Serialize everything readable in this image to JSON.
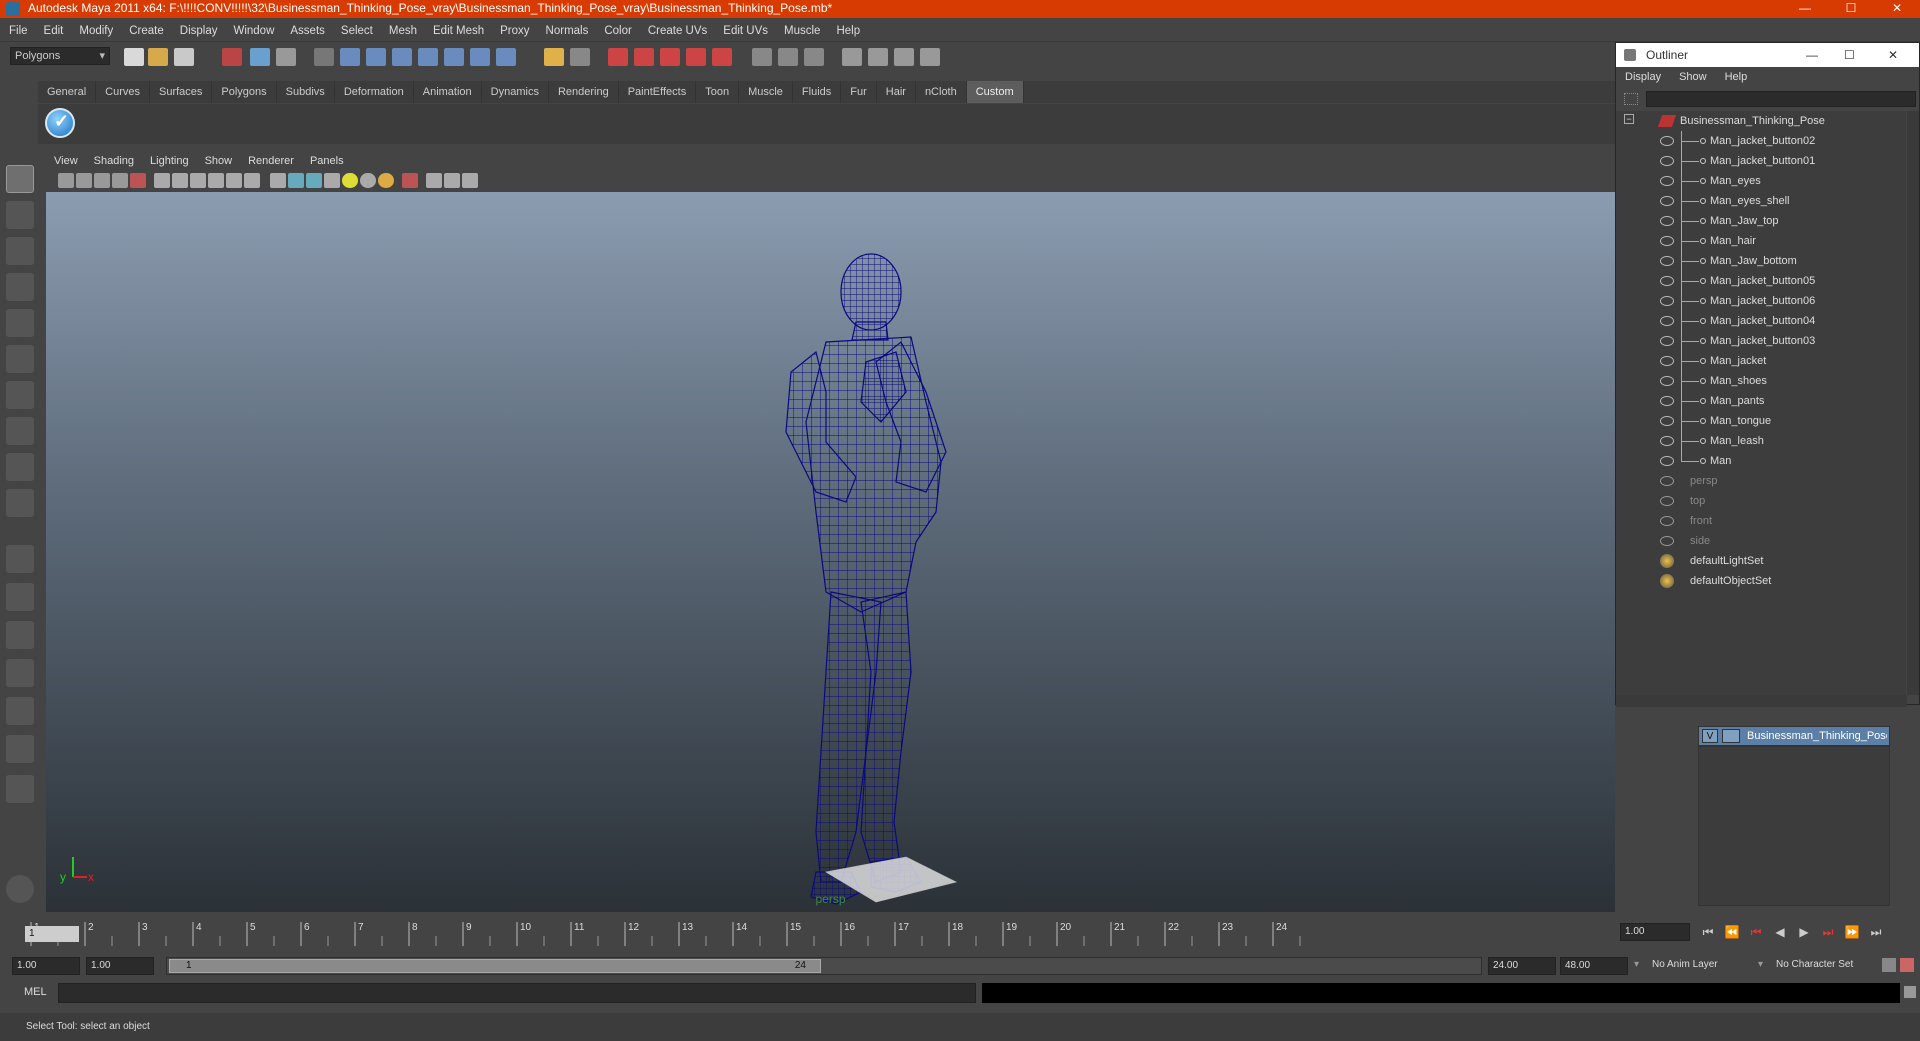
{
  "title": "Autodesk Maya 2011 x64: F:\\!!!!CONV!!!!!\\32\\Businessman_Thinking_Pose_vray\\Businessman_Thinking_Pose_vray\\Businessman_Thinking_Pose.mb*",
  "menu": [
    "File",
    "Edit",
    "Modify",
    "Create",
    "Display",
    "Window",
    "Assets",
    "Select",
    "Mesh",
    "Edit Mesh",
    "Proxy",
    "Normals",
    "Color",
    "Create UVs",
    "Edit UVs",
    "Muscle",
    "Help"
  ],
  "mode_select": "Polygons",
  "shelf_tabs": [
    "General",
    "Curves",
    "Surfaces",
    "Polygons",
    "Subdivs",
    "Deformation",
    "Animation",
    "Dynamics",
    "Rendering",
    "PaintEffects",
    "Toon",
    "Muscle",
    "Fluids",
    "Fur",
    "Hair",
    "nCloth",
    "Custom"
  ],
  "active_shelf_tab": "Custom",
  "viewport_menu": [
    "View",
    "Shading",
    "Lighting",
    "Show",
    "Renderer",
    "Panels"
  ],
  "viewport_label": "persp",
  "axis": {
    "y": "y",
    "x": "x"
  },
  "timeline": {
    "ticks": [
      "1",
      "2",
      "3",
      "4",
      "5",
      "6",
      "7",
      "8",
      "9",
      "10",
      "11",
      "12",
      "13",
      "14",
      "15",
      "16",
      "17",
      "18",
      "19",
      "20",
      "21",
      "22",
      "23",
      "24"
    ],
    "current_marker": "1",
    "current_frame": "1.00"
  },
  "range": {
    "start": "1.00",
    "anim_start": "1.00",
    "slider_start": "1",
    "slider_end": "24",
    "anim_end": "24.00",
    "end": "48.00",
    "anim_layer": "No Anim Layer",
    "char_set": "No Character Set"
  },
  "mel_label": "MEL",
  "help_text": "Select Tool: select an object",
  "outliner": {
    "title": "Outliner",
    "menu": [
      "Display",
      "Show",
      "Help"
    ],
    "root": "Businessman_Thinking_Pose",
    "children": [
      "Man_jacket_button02",
      "Man_jacket_button01",
      "Man_eyes",
      "Man_eyes_shell",
      "Man_Jaw_top",
      "Man_hair",
      "Man_Jaw_bottom",
      "Man_jacket_button05",
      "Man_jacket_button06",
      "Man_jacket_button04",
      "Man_jacket_button03",
      "Man_jacket",
      "Man_shoes",
      "Man_pants",
      "Man_tongue",
      "Man_leash",
      "Man"
    ],
    "cameras": [
      "persp",
      "top",
      "front",
      "side"
    ],
    "sets": [
      "defaultLightSet",
      "defaultObjectSet"
    ]
  },
  "layer": {
    "v": "V",
    "name": "Businessman_Thinking_Pose"
  },
  "colors": {
    "titlebar": "#d83b01",
    "wireframe": "#0a0a80",
    "panel": "#444444",
    "layer_highlight": "#5b7fa6"
  }
}
